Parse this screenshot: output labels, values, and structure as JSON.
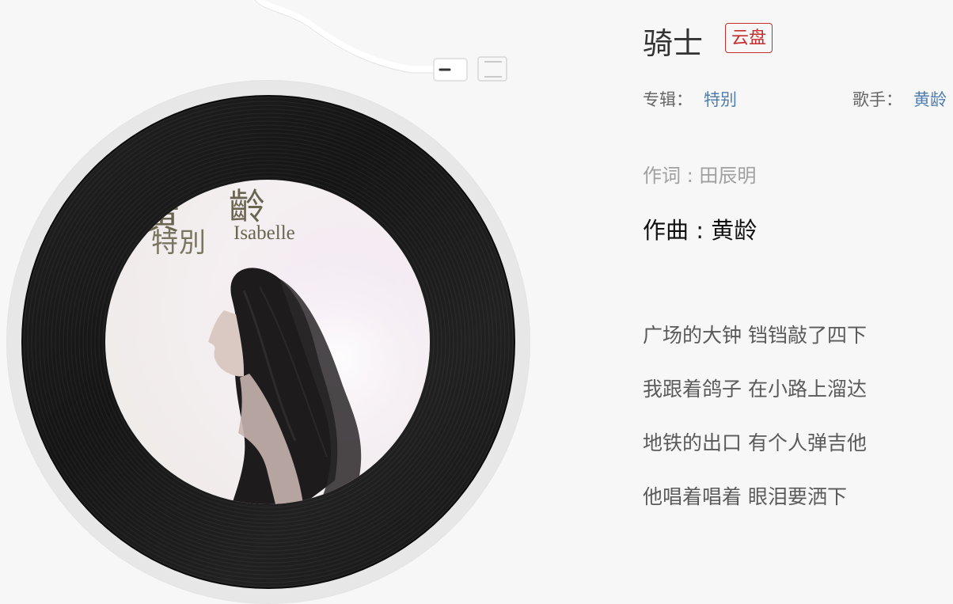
{
  "cover": {
    "artist_char_top": "齡",
    "artist_char_left": "黄",
    "album_text": "特別",
    "brand_text": "Isabelle"
  },
  "song": {
    "title": "骑士",
    "badge": "云盘",
    "album_label": "专辑：",
    "album": "特别",
    "artist_label": "歌手：",
    "artist": "黄龄"
  },
  "credits": {
    "lyricist": "作词 : 田辰明",
    "composer": "作曲 : 黄龄"
  },
  "lyrics": [
    "广场的大钟 铛铛敲了四下",
    "我跟着鸽子 在小路上溜达",
    "地铁的出口 有个人弹吉他",
    "他唱着唱着 眼泪要洒下"
  ],
  "colors": {
    "accent_red": "#c62f2f",
    "link_blue": "#507daf",
    "vinyl": "#111111",
    "page_bg": "#f7f7f7"
  }
}
